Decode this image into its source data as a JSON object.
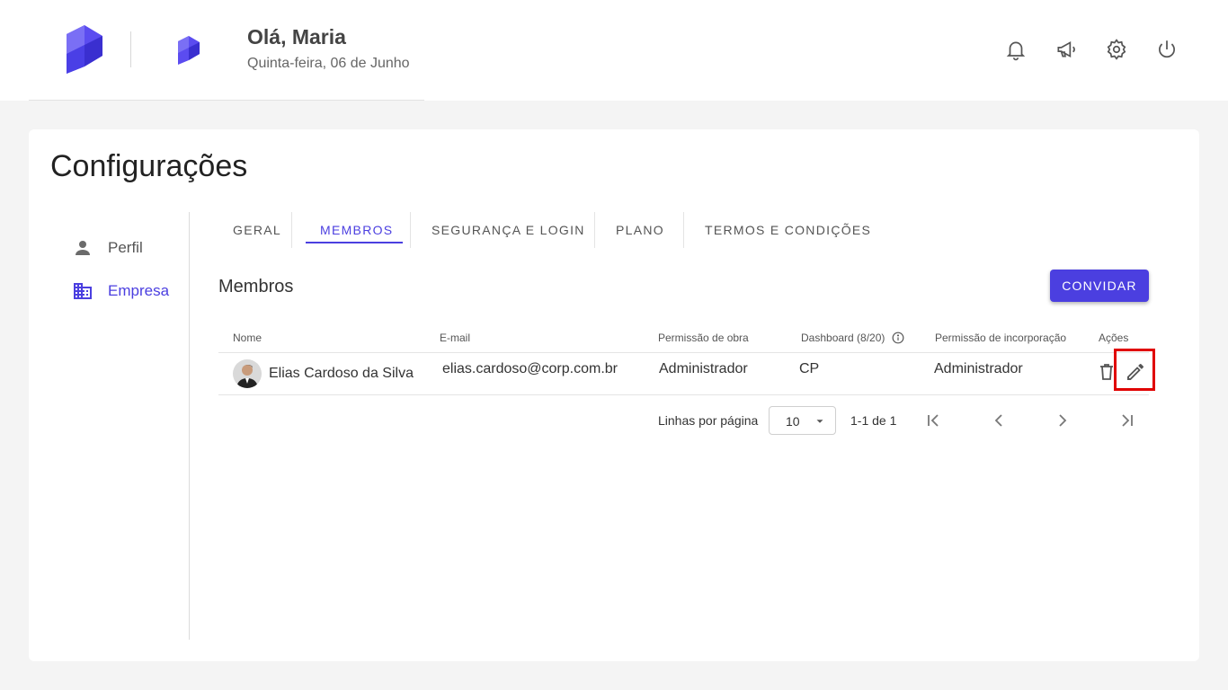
{
  "header": {
    "greeting": "Olá, Maria",
    "date": "Quinta-feira, 06 de Junho",
    "icons": [
      "bell-icon",
      "megaphone-icon",
      "gear-icon",
      "power-icon"
    ]
  },
  "page": {
    "title": "Configurações"
  },
  "sidebar": {
    "items": [
      {
        "label": "Perfil",
        "icon": "person-icon",
        "active": false
      },
      {
        "label": "Empresa",
        "icon": "building-icon",
        "active": true
      }
    ]
  },
  "tabs": [
    {
      "label": "GERAL",
      "active": false
    },
    {
      "label": "MEMBROS",
      "active": true
    },
    {
      "label": "SEGURANÇA E LOGIN",
      "active": false
    },
    {
      "label": "PLANO",
      "active": false
    },
    {
      "label": "TERMOS E CONDIÇÕES",
      "active": false
    }
  ],
  "members": {
    "title": "Membros",
    "invite_label": "CONVIDAR",
    "columns": [
      "Nome",
      "E-mail",
      "Permissão de obra",
      "Dashboard (8/20)",
      "Permissão de incorporação",
      "Ações"
    ],
    "rows": [
      {
        "name": "Elias Cardoso da Silva",
        "email": "elias.cardoso@corp.com.br",
        "work_permission": "Administrador",
        "dashboard": "CP",
        "incorporation_permission": "Administrador"
      }
    ]
  },
  "pagination": {
    "rows_per_page_label": "Linhas por página",
    "rows_per_page": "10",
    "range": "1-1 de 1"
  },
  "colors": {
    "accent": "#4b3fe0",
    "highlight": "#e00000"
  }
}
